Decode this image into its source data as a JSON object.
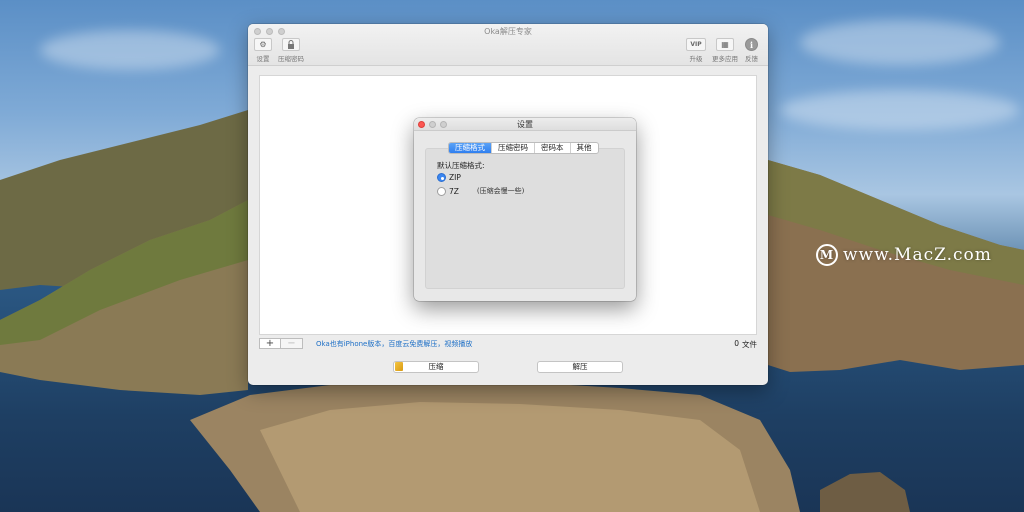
{
  "window": {
    "title": "Oka解压专家",
    "toolbar": {
      "left": [
        {
          "label": "设置",
          "icon": "gear-icon",
          "glyph": "⚙"
        },
        {
          "label": "压缩密码",
          "icon": "lock-icon",
          "glyph": "🔒"
        }
      ],
      "right": [
        {
          "label": "升级",
          "icon": "vip-icon",
          "glyph": "VIP"
        },
        {
          "label": "更多应用",
          "icon": "apps-grid-icon",
          "glyph": "▦"
        },
        {
          "label": "反馈",
          "icon": "info-icon",
          "glyph": "i"
        }
      ]
    },
    "bottom_bar": {
      "add_glyph": "+",
      "remove_glyph": "−",
      "promo_text": "Oka也有iPhone版本，百度云免费解压，视频播放",
      "file_count": "0",
      "file_count_unit": "文件"
    },
    "buttons": {
      "compress": "压缩",
      "extract": "解压"
    }
  },
  "dialog": {
    "title": "设置",
    "tabs": [
      "压缩格式",
      "压缩密码",
      "密码本",
      "其他"
    ],
    "active_tab": 0,
    "panel": {
      "label": "默认压缩格式:",
      "options": [
        {
          "label": "ZIP",
          "checked": true,
          "note": ""
        },
        {
          "label": "7Z",
          "checked": false,
          "note": "(压缩会慢一些)"
        }
      ]
    }
  },
  "desktop": {
    "watermark_logo": "M",
    "watermark_text": "www.MacZ.com"
  },
  "colors": {
    "accent": "#2f7ff0",
    "link": "#1d6fc6",
    "close_red": "#fc5753"
  }
}
